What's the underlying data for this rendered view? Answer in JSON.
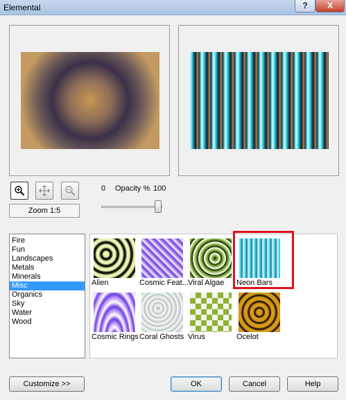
{
  "window": {
    "title": "Elemental",
    "help_glyph": "?",
    "close_glyph": "X"
  },
  "toolbar": {
    "zoom_label": "Zoom 1:5"
  },
  "opacity": {
    "min": "0",
    "label": "Opacity %",
    "max": "100",
    "value": 100
  },
  "categories": {
    "items": [
      "Fire",
      "Fun",
      "Landscapes",
      "Metals",
      "Minerals",
      "Misc",
      "Organics",
      "Sky",
      "Water",
      "Wood"
    ],
    "selected": "Misc"
  },
  "textures": {
    "items": [
      "Alien",
      "Cosmic Feat...",
      "Viral Algae",
      "Neon Bars",
      "Cosmic Rings",
      "Coral Ghosts",
      "Virus",
      "Ocelot"
    ],
    "highlighted": "Neon Bars"
  },
  "buttons": {
    "customize": "Customize  >>",
    "ok": "OK",
    "cancel": "Cancel",
    "help": "Help"
  }
}
